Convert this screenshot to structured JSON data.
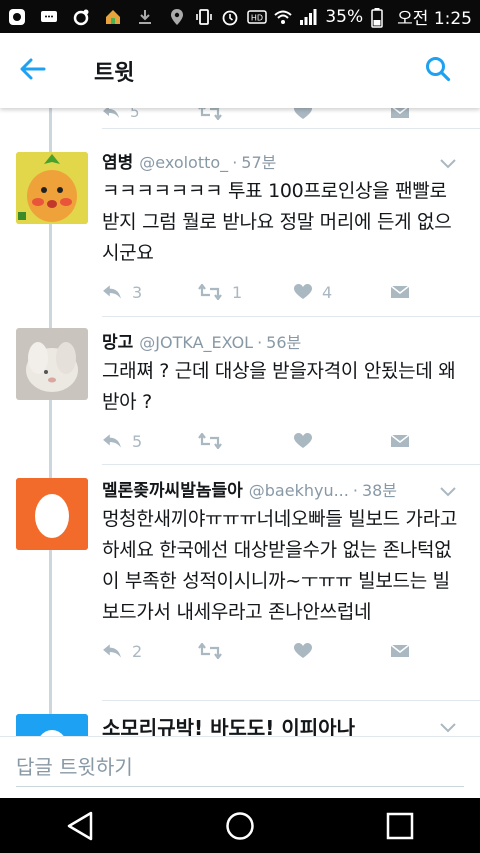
{
  "status_bar": {
    "battery_percent": "35%",
    "time": "오전 1:25"
  },
  "app_bar": {
    "title": "트윗"
  },
  "previous_tweet_actions": {
    "reply_count": "5"
  },
  "tweets": [
    {
      "name": "염병",
      "handle": "@exolotto_",
      "time": "57분",
      "text": "ㅋㅋㅋㅋㅋㅋㅋ 투표 100프로인상을 팬빨로 받지 그럼 뭘로 받나요 정말 머리에 든게 없으시군요",
      "reply_count": "3",
      "retweet_count": "1",
      "like_count": "4"
    },
    {
      "name": "망고",
      "handle": "@JOTKA_EXOL",
      "time": "56분",
      "text": "그래쪄 ? 근데 대상을 받을자격이 안됬는데 왜 받아 ?",
      "reply_count": "5",
      "retweet_count": "",
      "like_count": ""
    },
    {
      "name": "멜론좆까씨발놈들아",
      "handle": "@baekhyu...",
      "time": "38분",
      "text": "멍청한새끼야ㅠㅠㅠ너네오빠들 빌보드 가라고 하세요 한국에선 대상받을수가 없는 존나턱없이 부족한 성적이시니까~ㅜㅠㅠ 빌보드는 빌보드가서 내세우라고 존나안쓰럽네",
      "reply_count": "2",
      "retweet_count": "",
      "like_count": ""
    },
    {
      "name": "소모리규박! 바도도! 이피아나",
      "handle": "",
      "time": "",
      "text": "",
      "reply_count": "",
      "retweet_count": "",
      "like_count": ""
    }
  ],
  "compose": {
    "placeholder": "답글 트윗하기"
  },
  "colors": {
    "accent": "#1da1f2",
    "action_gray": "#aab8c2",
    "egg_orange": "#f26b2b"
  }
}
